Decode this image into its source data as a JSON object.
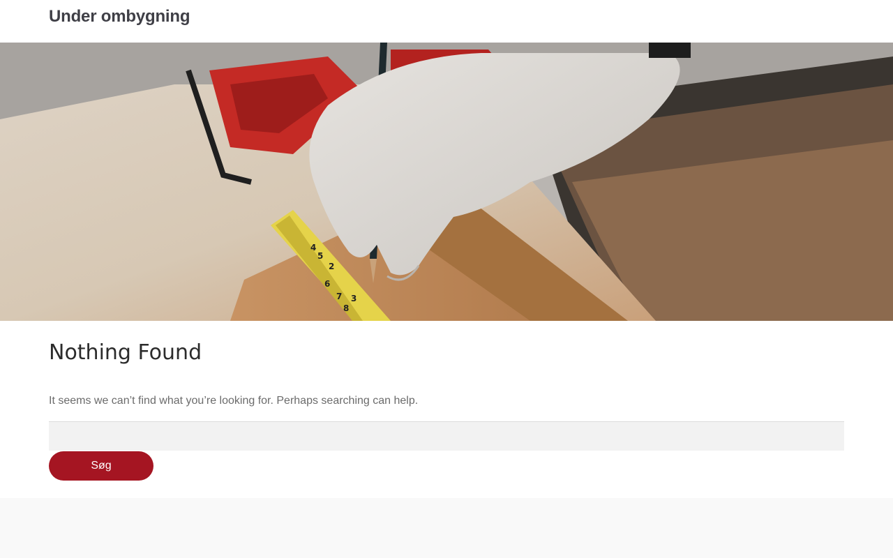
{
  "site": {
    "title": "Under ombygning"
  },
  "hero": {
    "image_alt": "Hands in a knitted work glove marking wood with a pencil next to a measuring tape",
    "tape_marks": [
      "2",
      "3",
      "4",
      "5",
      "6",
      "7",
      "8"
    ]
  },
  "main": {
    "heading": "Nothing Found",
    "message": "It seems we can’t find what you’re looking for. Perhaps searching can help.",
    "search": {
      "value": "",
      "placeholder": "",
      "button_label": "Søg"
    }
  },
  "colors": {
    "accent": "#a51522",
    "title": "#3f3f46",
    "heading": "#2b2b2b",
    "body_text": "#6b6b6b",
    "input_bg": "#f2f2f2",
    "footer_bg": "#f9f9f9"
  }
}
